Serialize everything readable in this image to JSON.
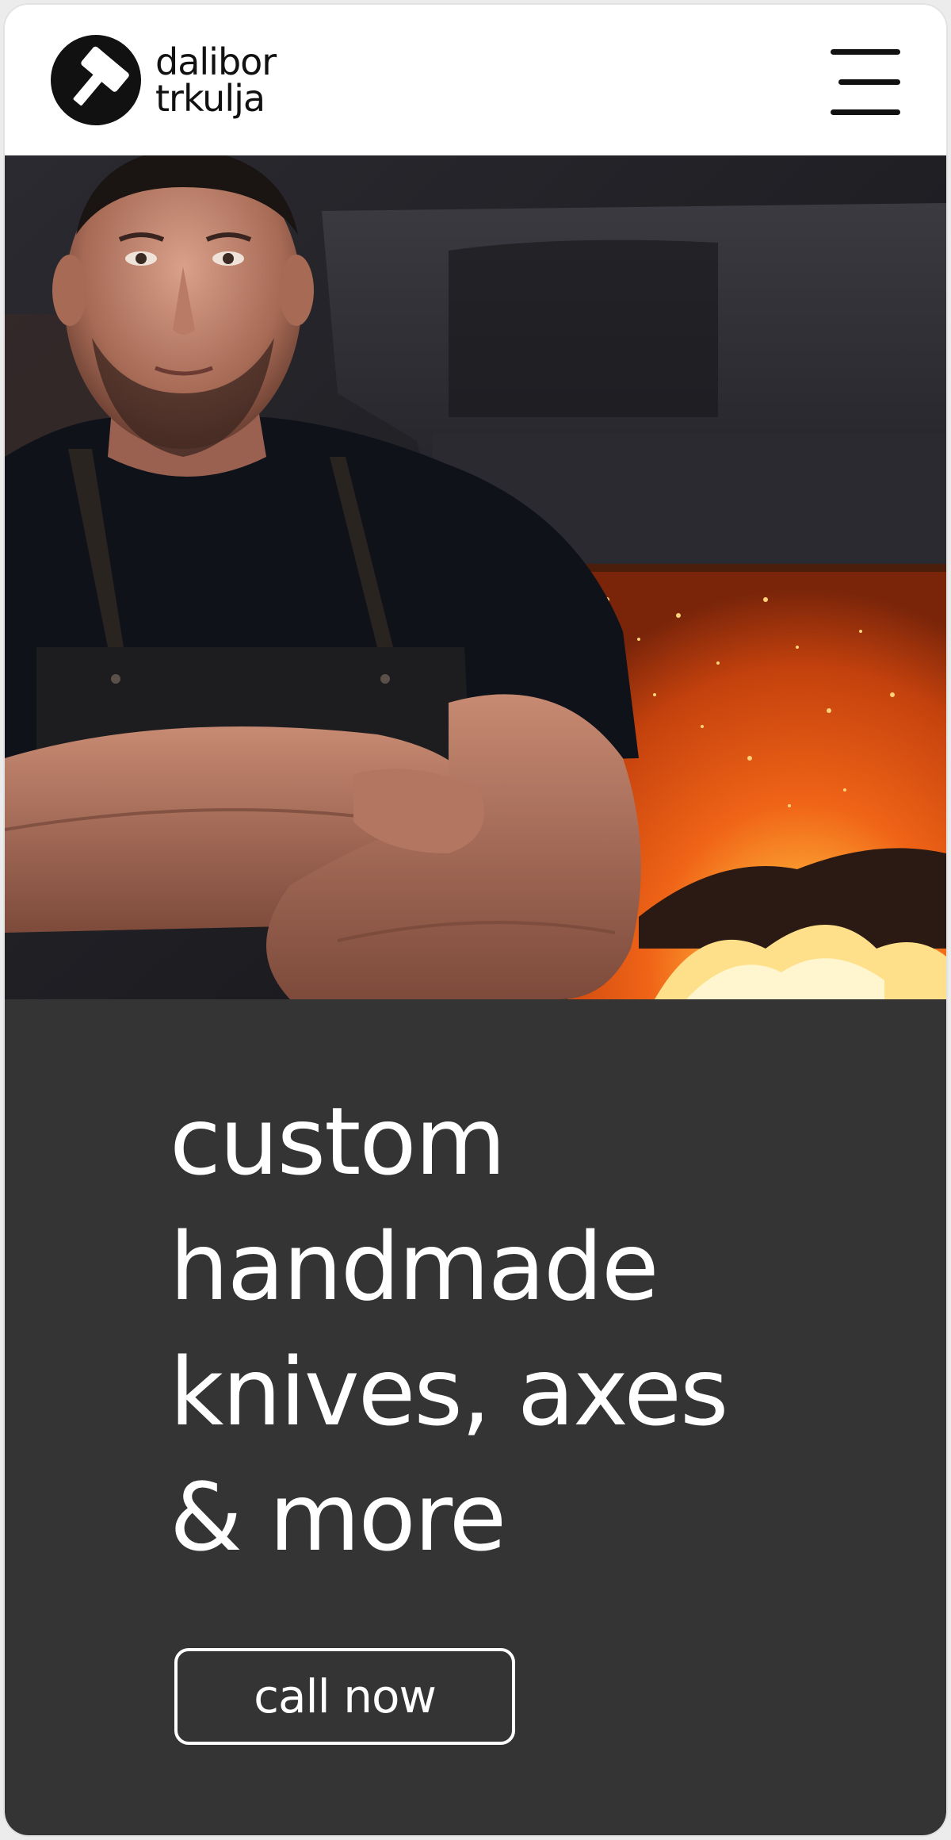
{
  "header": {
    "logo_line1": "dalibor",
    "logo_line2": "trkulja",
    "logo_icon": "hammer-icon",
    "menu_icon": "hamburger-menu-icon"
  },
  "hero": {
    "image_subject": "blacksmith with crossed arms in front of forge fire"
  },
  "intro": {
    "headline_lines": [
      "custom",
      "handmade",
      "knives, axes",
      "& more"
    ],
    "cta_label": "call now"
  },
  "colors": {
    "header_bg": "#ffffff",
    "section_bg": "#353434",
    "text_light": "#ffffff",
    "text_dark": "#111111",
    "fire_orange": "#ff6a1a"
  }
}
